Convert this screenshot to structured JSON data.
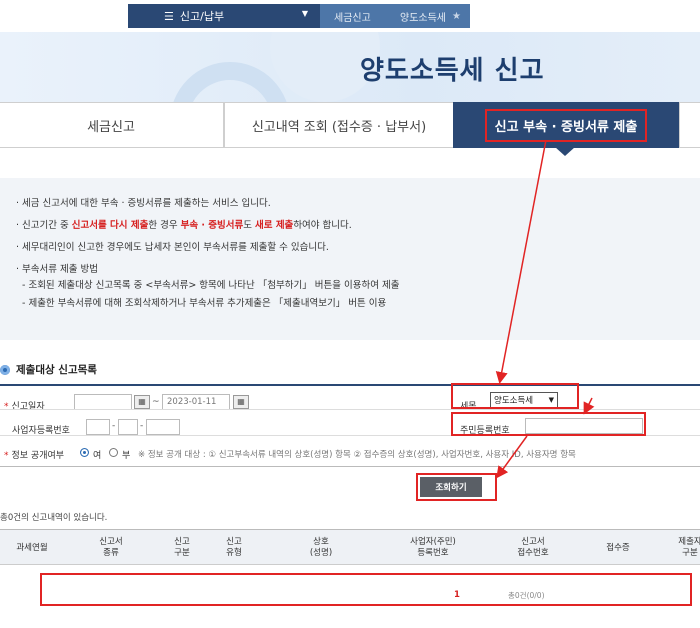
{
  "topnav": {
    "menu_label": "신고/납부",
    "crumbs": [
      "세금신고",
      "양도소득세"
    ]
  },
  "banner": {
    "title": "양도소득세 신고"
  },
  "tabs": [
    {
      "label": "세금신고"
    },
    {
      "label": "신고내역 조회 (접수증 · 납부서)"
    },
    {
      "label": "신고 부속 · 증빙서류 제출",
      "active": true
    }
  ],
  "info": {
    "line1": "· 세금 신고서에 대한 부속 · 증빙서류를 제출하는 서비스 입니다.",
    "line2": {
      "a": "· 신고기간 중 ",
      "b": "신고서를 다시 제출",
      "c": "한 경우 ",
      "d": "부속 · 증빙서류",
      "e": "도 ",
      "f": "새로 제출",
      "g": "하여야 합니다."
    },
    "line3": "· 세무대리인이 신고한 경우에도 납세자 본인이 부속서류를 제출할 수 있습니다.",
    "line4": "· 부속서류 제출 방법",
    "line5": "- 조회된 제출대상 신고목록 중 <부속서류> 항목에 나타난 「첨부하기」 버튼을 이용하여 제출",
    "line6": "- 제출한 부속서류에 대해 조회삭제하거나 부속서류 추가제출은 「제출내역보기」 버튼 이용"
  },
  "section_title": "제출대상 신고목록",
  "form": {
    "date_label": "신고일자",
    "date_from": "",
    "date_to": "2023-01-11",
    "tax_label": "세목",
    "tax_selected": "양도소득세",
    "bizno_label": "사업자등록번호",
    "rrn_label": "주민등록번호",
    "disclosure_label": "정보 공개여부",
    "yes_label": "여",
    "no_label": "부",
    "note": "※ 정보 공개 대상 : ① 신고부속서류 내역의 상호(성명) 항목 ② 접수증의 상호(성명), 사업자번호, 사용자 ID, 사용자명 항목",
    "search_button": "조회하기"
  },
  "result_count": "총0건의 신고내역이 있습니다.",
  "table": {
    "headers": [
      "과세연월",
      "신고서\n종류",
      "신고\n구분",
      "신고\n유형",
      "상호\n(성명)",
      "사업자(주민)\n등록번호",
      "신고서\n접수번호",
      "접수증",
      "제출자\n구분"
    ]
  },
  "pager": {
    "page": "1",
    "total": "총0건(0/0)"
  },
  "colors": {
    "navy": "#2a4874",
    "highlight": "#e12424"
  }
}
